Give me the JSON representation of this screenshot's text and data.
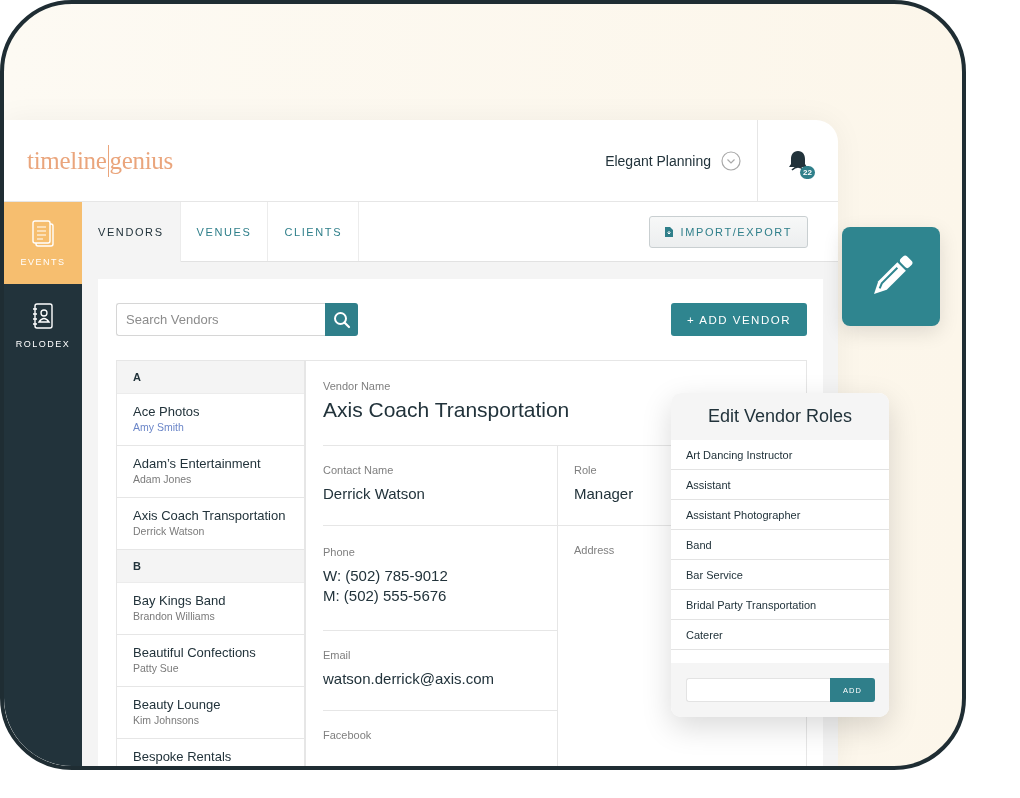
{
  "logo": {
    "first": "timeline",
    "second": "genius"
  },
  "account": {
    "name": "Elegant Planning"
  },
  "notifications": {
    "count": "22"
  },
  "sidebar": {
    "items": [
      {
        "label": "EVENTS",
        "kind": "events",
        "selected": true
      },
      {
        "label": "ROLODEX",
        "kind": "rolodex",
        "selected": false
      }
    ]
  },
  "tabs": [
    {
      "label": "VENDORS",
      "selected": true
    },
    {
      "label": "VENUES",
      "selected": false
    },
    {
      "label": "CLIENTS",
      "selected": false
    }
  ],
  "import_button": {
    "label": "IMPORT/EXPORT"
  },
  "search": {
    "placeholder": "Search Vendors"
  },
  "add_button": {
    "label": "+ ADD VENDOR"
  },
  "vendor_groups": [
    {
      "letter": "A",
      "vendors": [
        {
          "name": "Ace Photos",
          "contact": "Amy Smith",
          "hovered": true
        },
        {
          "name": "Adam’s Entertainment",
          "contact": "Adam Jones",
          "hovered": false
        },
        {
          "name": "Axis Coach Transportation",
          "contact": "Derrick Watson",
          "hovered": false
        }
      ]
    },
    {
      "letter": "B",
      "vendors": [
        {
          "name": "Bay Kings Band",
          "contact": "Brandon Williams",
          "hovered": false
        },
        {
          "name": "Beautiful Confections",
          "contact": "Patty Sue",
          "hovered": false
        },
        {
          "name": "Beauty Lounge",
          "contact": "Kim Johnsons",
          "hovered": false
        },
        {
          "name": "Bespoke Rentals"
        }
      ]
    }
  ],
  "detail": {
    "vendor_name_label": "Vendor Name",
    "vendor_name": "Axis Coach Transportation",
    "left_fields": [
      {
        "label": "Contact Name",
        "values": [
          "Derrick Watson"
        ]
      },
      {
        "label": "Phone",
        "values": [
          "W: (502) 785-9012",
          "M:  (502) 555-5676"
        ]
      },
      {
        "label": "Email",
        "values": [
          "watson.derrick@axis.com"
        ]
      },
      {
        "label": "Facebook"
      }
    ],
    "right_fields": [
      {
        "label": "Role",
        "values": [
          "Manager"
        ]
      },
      {
        "label": "Address"
      }
    ]
  },
  "role_editor": {
    "title": "Edit Vendor Roles",
    "roles": [
      "Art Dancing Instructor",
      "Assistant",
      "Assistant Photographer",
      "Band",
      "Bar Service",
      "Bridal Party Transportation",
      "Caterer"
    ],
    "add_button": "ADD"
  }
}
